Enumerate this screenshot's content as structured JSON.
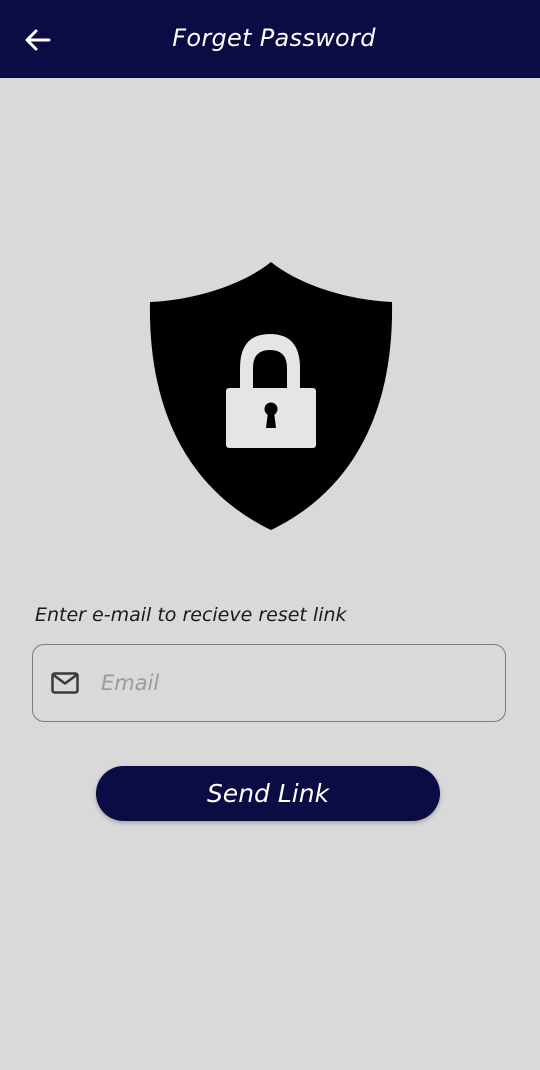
{
  "appbar": {
    "title": "Forget Password",
    "back_icon": "arrow-left-icon",
    "background_color": "#0c0c45"
  },
  "illustration": {
    "icon": "shield-lock-icon"
  },
  "form": {
    "label": "Enter e-mail to recieve reset link",
    "email": {
      "icon": "mail-icon",
      "placeholder": "Email",
      "value": ""
    },
    "submit_label": "Send Link"
  },
  "colors": {
    "primary": "#0c0c45",
    "background": "#d9d9d9"
  }
}
